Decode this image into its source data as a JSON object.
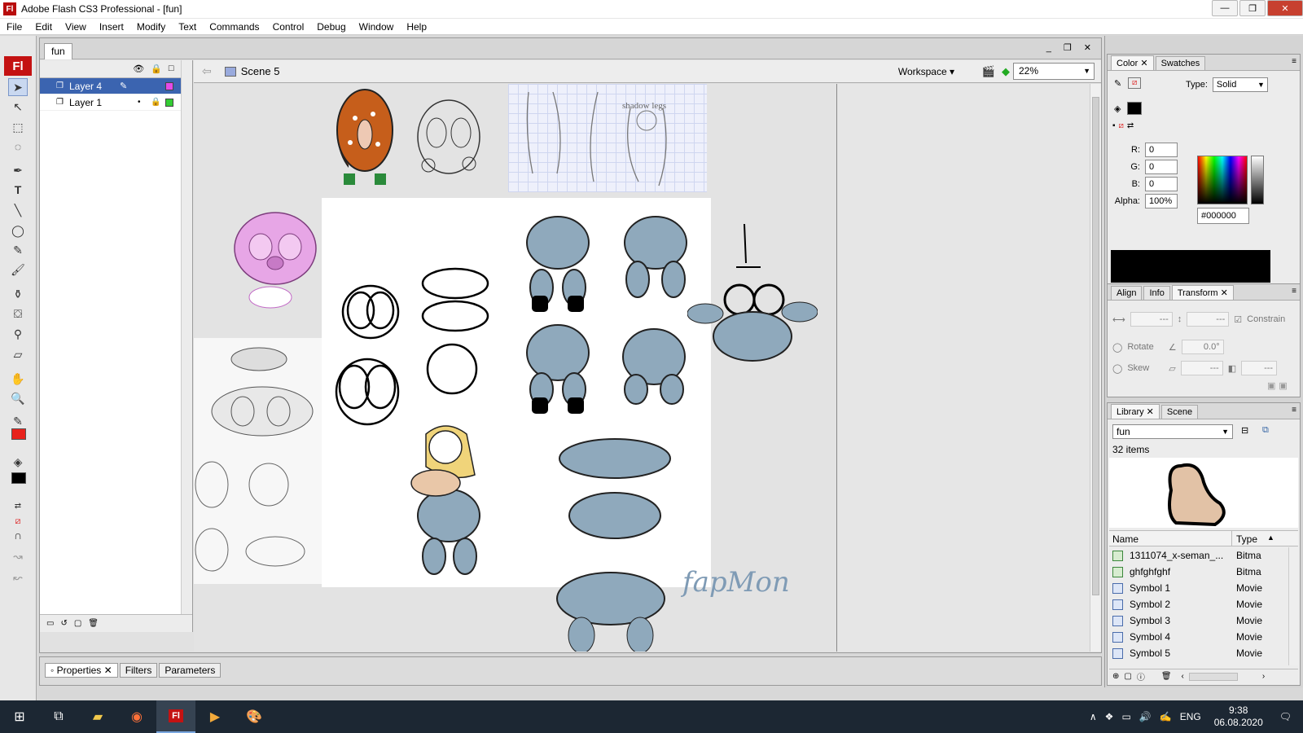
{
  "window": {
    "app_icon": "Fl",
    "title": "Adobe Flash CS3 Professional - [fun]",
    "buttons": [
      "minimize",
      "restore",
      "close"
    ]
  },
  "menubar": [
    "File",
    "Edit",
    "View",
    "Insert",
    "Modify",
    "Text",
    "Commands",
    "Control",
    "Debug",
    "Window",
    "Help"
  ],
  "tools": {
    "logo": "Fl",
    "stroke_color": "#000000",
    "fill_color": "#e8221c"
  },
  "document": {
    "tab": "fun",
    "scene": "Scene 5",
    "workspace": "Workspace",
    "zoom": "22%",
    "stage_text": "fapMon"
  },
  "timeline": {
    "layers": [
      {
        "name": "Layer 4",
        "color": "#e44ae8",
        "selected": true
      },
      {
        "name": "Layer 1",
        "color": "#33cc33",
        "selected": false
      }
    ]
  },
  "properties_bar": {
    "tabs": [
      "Properties",
      "Filters",
      "Parameters"
    ]
  },
  "color_panel": {
    "tabs": [
      "Color",
      "Swatches"
    ],
    "type_label": "Type:",
    "type_value": "Solid",
    "r_label": "R:",
    "r": "0",
    "g_label": "G:",
    "g": "0",
    "b_label": "B:",
    "b": "0",
    "alpha_label": "Alpha:",
    "alpha": "100%",
    "hex": "#000000",
    "preview_color": "#000000"
  },
  "transform_panel": {
    "tabs": [
      "Align",
      "Info",
      "Transform"
    ],
    "width": "---",
    "height": "---",
    "constrain": "Constrain",
    "rotate": "Rotate",
    "rotate_value": "0.0°",
    "skew": "Skew",
    "skew_h": "---",
    "skew_v": "---"
  },
  "library_panel": {
    "tabs": [
      "Library",
      "Scene"
    ],
    "library": "fun",
    "count": "32 items",
    "col_name": "Name",
    "col_type": "Type",
    "items": [
      {
        "name": "1311074_x-seman_...",
        "type": "Bitma",
        "kind": "bitmap"
      },
      {
        "name": "ghfghfghf",
        "type": "Bitma",
        "kind": "bitmap"
      },
      {
        "name": "Symbol 1",
        "type": "Movie",
        "kind": "movie"
      },
      {
        "name": "Symbol 2",
        "type": "Movie",
        "kind": "movie"
      },
      {
        "name": "Symbol 3",
        "type": "Movie",
        "kind": "movie"
      },
      {
        "name": "Symbol 4",
        "type": "Movie",
        "kind": "movie"
      },
      {
        "name": "Symbol 5",
        "type": "Movie",
        "kind": "movie"
      }
    ]
  },
  "taskbar": {
    "apps": [
      "start",
      "task-view",
      "file-explorer",
      "firefox",
      "flash",
      "media-player",
      "paint"
    ],
    "language": "ENG",
    "time": "9:38",
    "date": "06.08.2020"
  }
}
